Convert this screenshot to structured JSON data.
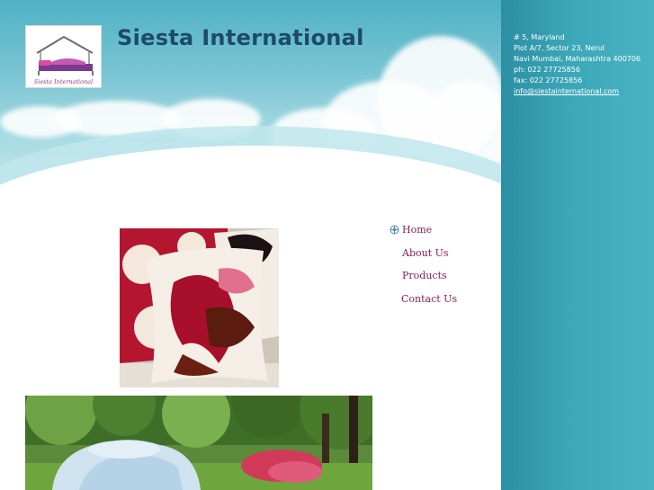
{
  "site": {
    "title": "Siesta International",
    "logo_text": "Siesta International"
  },
  "contact": {
    "address_line1": "# 5, Maryland",
    "address_line2": "Plot A/7, Sector 23, Nerul",
    "address_line3": "Navi Mumbai, Maharashtra 400706",
    "phone": "ph: 022 27725856",
    "fax": "fax: 022 27725856",
    "email": "info@siestainternational.com"
  },
  "nav": {
    "items": [
      {
        "label": "Home",
        "icon": "home-bullet-icon"
      },
      {
        "label": "About Us"
      },
      {
        "label": "Products"
      },
      {
        "label": "Contact Us"
      }
    ]
  },
  "images": {
    "pillows": "decorative-cushions-photo",
    "garden": "garden-bed-photo"
  },
  "colors": {
    "title": "#1e4a66",
    "nav": "#8a1f4a",
    "sidebar": "#3ca7b8",
    "sky": "#76c3d2"
  }
}
